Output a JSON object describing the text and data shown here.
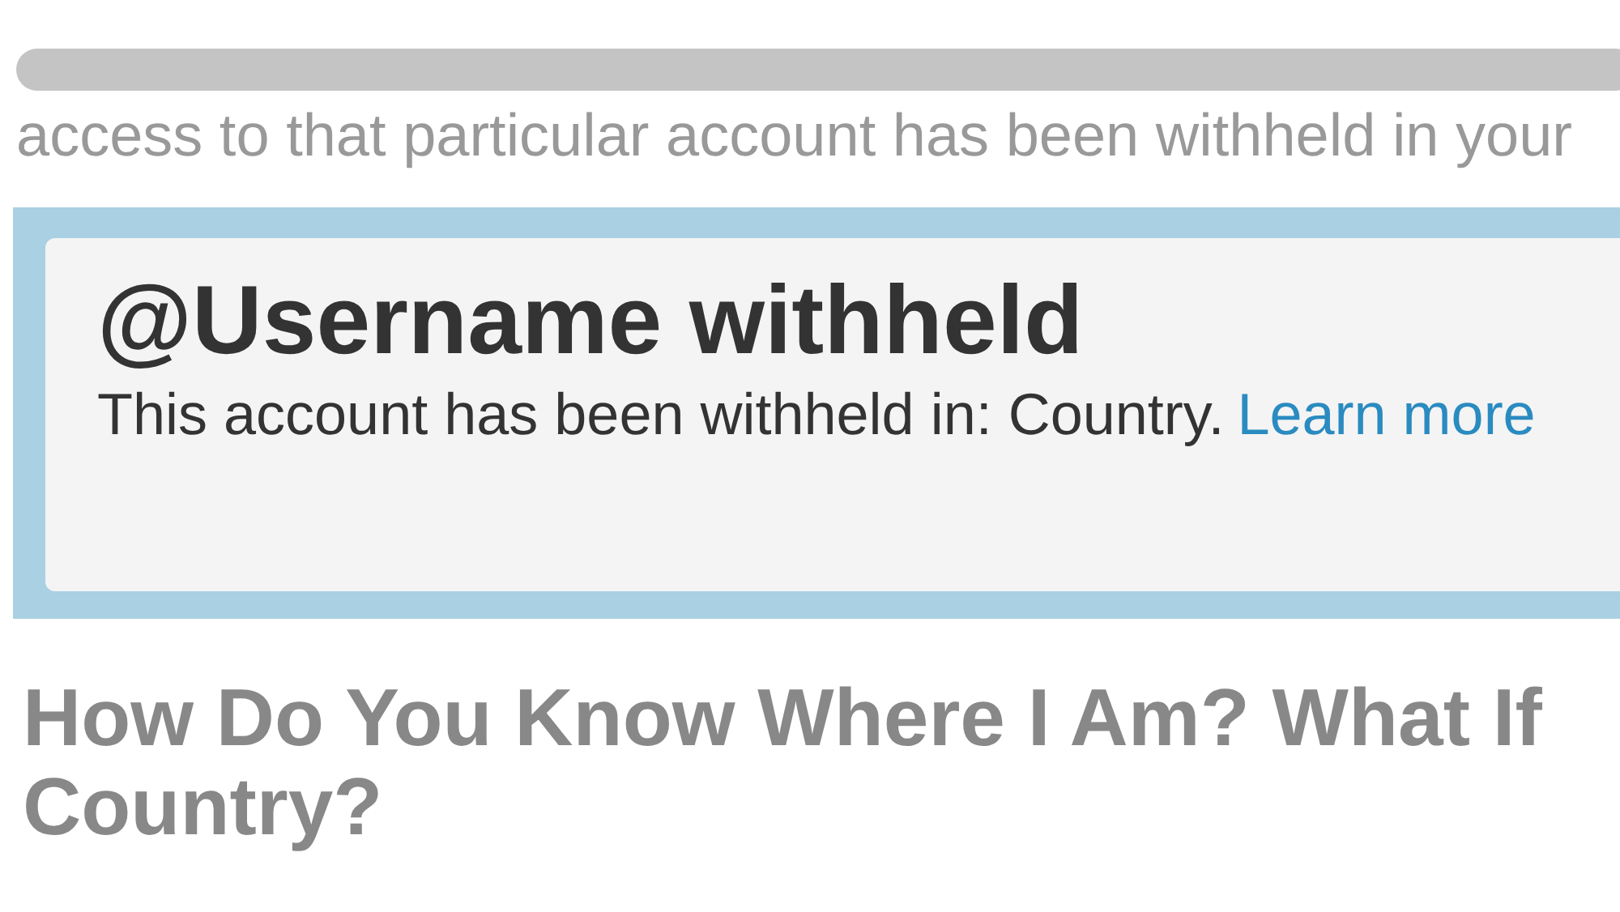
{
  "intro_text": "access to that particular account has been withheld in your",
  "notice": {
    "title": "@Username withheld",
    "message": "This account has been withheld in: Country.",
    "link": "Learn more"
  },
  "section_heading": [
    "How Do You Know Where I Am? What If",
    "Country?"
  ]
}
